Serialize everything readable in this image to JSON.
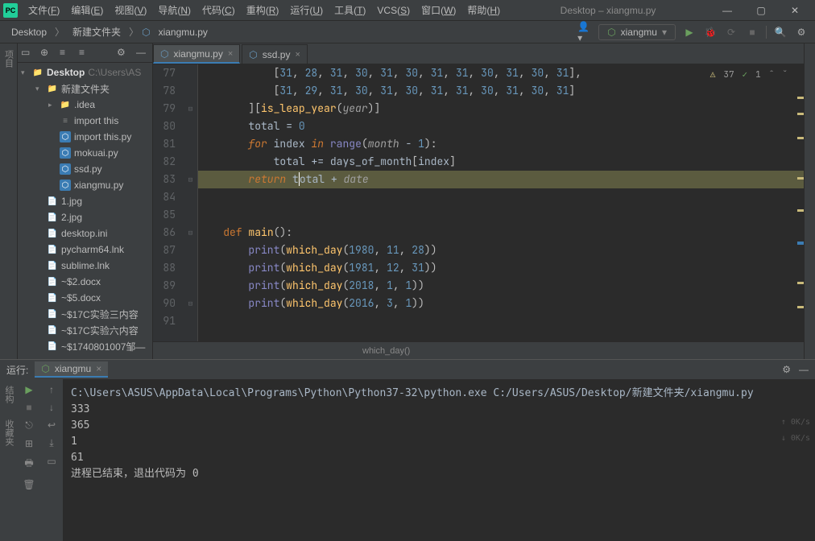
{
  "menu": {
    "items": [
      "文件(F)",
      "编辑(E)",
      "视图(V)",
      "导航(N)",
      "代码(C)",
      "重构(R)",
      "运行(U)",
      "工具(T)",
      "VCS(S)",
      "窗口(W)",
      "帮助(H)"
    ]
  },
  "window": {
    "title": "Desktop – xiangmu.py"
  },
  "breadcrumbs": {
    "root": "Desktop",
    "folder": "新建文件夹",
    "file": "xiangmu.py"
  },
  "run_config": {
    "name": "xiangmu"
  },
  "inspections": {
    "warnings": 37,
    "weak": 1
  },
  "tree": {
    "root": {
      "name": "Desktop",
      "path": "C:\\Users\\AS"
    },
    "items": [
      {
        "depth": 1,
        "arrow": "▾",
        "icon": "dir",
        "label": "新建文件夹"
      },
      {
        "depth": 2,
        "arrow": "▸",
        "icon": "dir",
        "label": ".idea"
      },
      {
        "depth": 2,
        "arrow": "",
        "icon": "txt",
        "label": "import this"
      },
      {
        "depth": 2,
        "arrow": "",
        "icon": "py",
        "label": "import this.py"
      },
      {
        "depth": 2,
        "arrow": "",
        "icon": "py",
        "label": "mokuai.py"
      },
      {
        "depth": 2,
        "arrow": "",
        "icon": "py",
        "label": "ssd.py"
      },
      {
        "depth": 2,
        "arrow": "",
        "icon": "py",
        "label": "xiangmu.py"
      },
      {
        "depth": 1,
        "arrow": "",
        "icon": "file",
        "label": "1.jpg"
      },
      {
        "depth": 1,
        "arrow": "",
        "icon": "file",
        "label": "2.jpg"
      },
      {
        "depth": 1,
        "arrow": "",
        "icon": "file",
        "label": "desktop.ini"
      },
      {
        "depth": 1,
        "arrow": "",
        "icon": "file",
        "label": "pycharm64.lnk"
      },
      {
        "depth": 1,
        "arrow": "",
        "icon": "file",
        "label": "sublime.lnk"
      },
      {
        "depth": 1,
        "arrow": "",
        "icon": "file",
        "label": "~$2.docx"
      },
      {
        "depth": 1,
        "arrow": "",
        "icon": "file",
        "label": "~$5.docx"
      },
      {
        "depth": 1,
        "arrow": "",
        "icon": "file",
        "label": "~$17C实验三内容"
      },
      {
        "depth": 1,
        "arrow": "",
        "icon": "file",
        "label": "~$17C实验六内容"
      },
      {
        "depth": 1,
        "arrow": "",
        "icon": "file",
        "label": "~$1740801007邹—"
      }
    ]
  },
  "editor": {
    "tabs": [
      {
        "name": "xiangmu.py",
        "active": true
      },
      {
        "name": "ssd.py",
        "active": false
      }
    ],
    "lines": [
      {
        "n": 77,
        "html": "            [<span class='tok-num'>31</span>, <span class='tok-num'>28</span>, <span class='tok-num'>31</span>, <span class='tok-num'>30</span>, <span class='tok-num'>31</span>, <span class='tok-num'>30</span>, <span class='tok-num'>31</span>, <span class='tok-num'>31</span>, <span class='tok-num'>30</span>, <span class='tok-num'>31</span>, <span class='tok-num'>30</span>, <span class='tok-num'>31</span>],"
      },
      {
        "n": 78,
        "html": "            [<span class='tok-num'>31</span>, <span class='tok-num'>29</span>, <span class='tok-num'>31</span>, <span class='tok-num'>30</span>, <span class='tok-num'>31</span>, <span class='tok-num'>30</span>, <span class='tok-num'>31</span>, <span class='tok-num'>31</span>, <span class='tok-num'>30</span>, <span class='tok-num'>31</span>, <span class='tok-num'>30</span>, <span class='tok-num'>31</span>]"
      },
      {
        "n": 79,
        "html": "        ][<span class='tok-fn'>is_leap_year</span>(<span class='tok-param'>year</span>)]",
        "fold": "⊟"
      },
      {
        "n": 80,
        "html": "        <span class='tok-var'>total</span> <span class='tok-op'>=</span> <span class='tok-num'>0</span>"
      },
      {
        "n": 81,
        "html": "        <span class='tok-kw'>for</span> <span class='tok-var'>index</span> <span class='tok-kw'>in</span> <span class='tok-builtin'>range</span>(<span class='tok-param'>month</span> <span class='tok-op'>-</span> <span class='tok-num'>1</span>):"
      },
      {
        "n": 82,
        "html": "            <span class='tok-var'>total</span> <span class='tok-op'>+=</span> <span class='tok-var'>days_of_month</span>[<span class='tok-var'>index</span>]"
      },
      {
        "n": 83,
        "html": "        <span class='tok-kw'>return</span> <span class='tok-var'>t<span style='border-left:1px solid #fff'></span>otal</span> <span class='tok-op'>+</span> <span class='tok-param'>date</span>",
        "caret": true,
        "fold": "⊟"
      },
      {
        "n": 84,
        "html": ""
      },
      {
        "n": 85,
        "html": ""
      },
      {
        "n": 86,
        "html": "    <span class='tok-def'>def</span> <span class='tok-fn'>main</span>():",
        "fold": "⊟"
      },
      {
        "n": 87,
        "html": "        <span class='tok-builtin'>print</span>(<span class='tok-fn'>which_day</span>(<span class='tok-num'>1980</span>, <span class='tok-num'>11</span>, <span class='tok-num'>28</span>))"
      },
      {
        "n": 88,
        "html": "        <span class='tok-builtin'>print</span>(<span class='tok-fn'>which_day</span>(<span class='tok-num'>1981</span>, <span class='tok-num'>12</span>, <span class='tok-num'>31</span>))"
      },
      {
        "n": 89,
        "html": "        <span class='tok-builtin'>print</span>(<span class='tok-fn'>which_day</span>(<span class='tok-num'>2018</span>, <span class='tok-num'>1</span>, <span class='tok-num'>1</span>))"
      },
      {
        "n": 90,
        "html": "        <span class='tok-builtin'>print</span>(<span class='tok-fn'>which_day</span>(<span class='tok-num'>2016</span>, <span class='tok-num'>3</span>, <span class='tok-num'>1</span>))",
        "fold": "⊟"
      },
      {
        "n": 91,
        "html": ""
      }
    ],
    "breadcrumb_fn": "which_day()"
  },
  "run": {
    "title": "运行:",
    "tab": "xiangmu",
    "cmd": "C:\\Users\\ASUS\\AppData\\Local\\Programs\\Python\\Python37-32\\python.exe C:/Users/ASUS/Desktop/新建文件夹/xiangmu.py",
    "out": [
      "333",
      "365",
      "1",
      "61",
      "",
      "进程已结束，退出代码为 0"
    ],
    "net": "0K/s"
  },
  "sidebar_labs": {
    "left": [
      "项目"
    ],
    "bottom_left": [
      "结构",
      "收藏夹"
    ]
  }
}
